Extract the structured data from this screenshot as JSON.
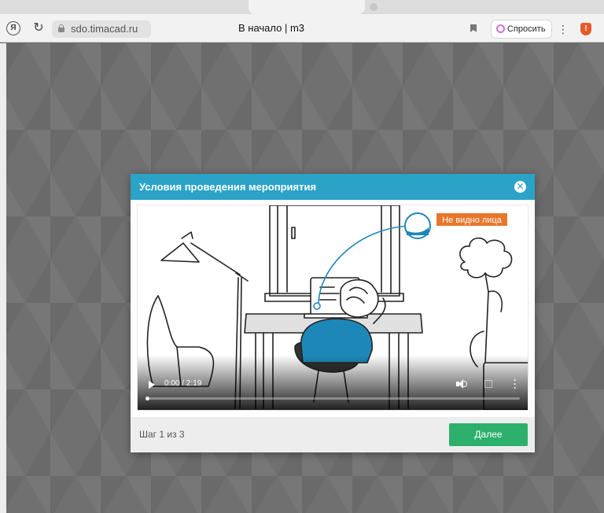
{
  "browser": {
    "address": "sdo.timacad.ru",
    "page_title": "В начало | m3",
    "ask_button_label": "Спросить",
    "icons": [
      "yandex-icon",
      "reload-icon",
      "lock-icon",
      "bookmark-icon",
      "alice-icon",
      "more-icon",
      "shield-icon"
    ]
  },
  "modal": {
    "title": "Условия проведения мероприятия",
    "video": {
      "overlay_label": "Не видно лица",
      "time": "0:00 / 2:19",
      "progress": 0
    },
    "step_text": "Шаг 1 из 3",
    "next_label": "Далее"
  },
  "colors": {
    "header": "#2aa3c7",
    "next_button": "#2db06c",
    "overlay_label": "#e8762c",
    "illustration_accent": "#2a8fc0"
  }
}
